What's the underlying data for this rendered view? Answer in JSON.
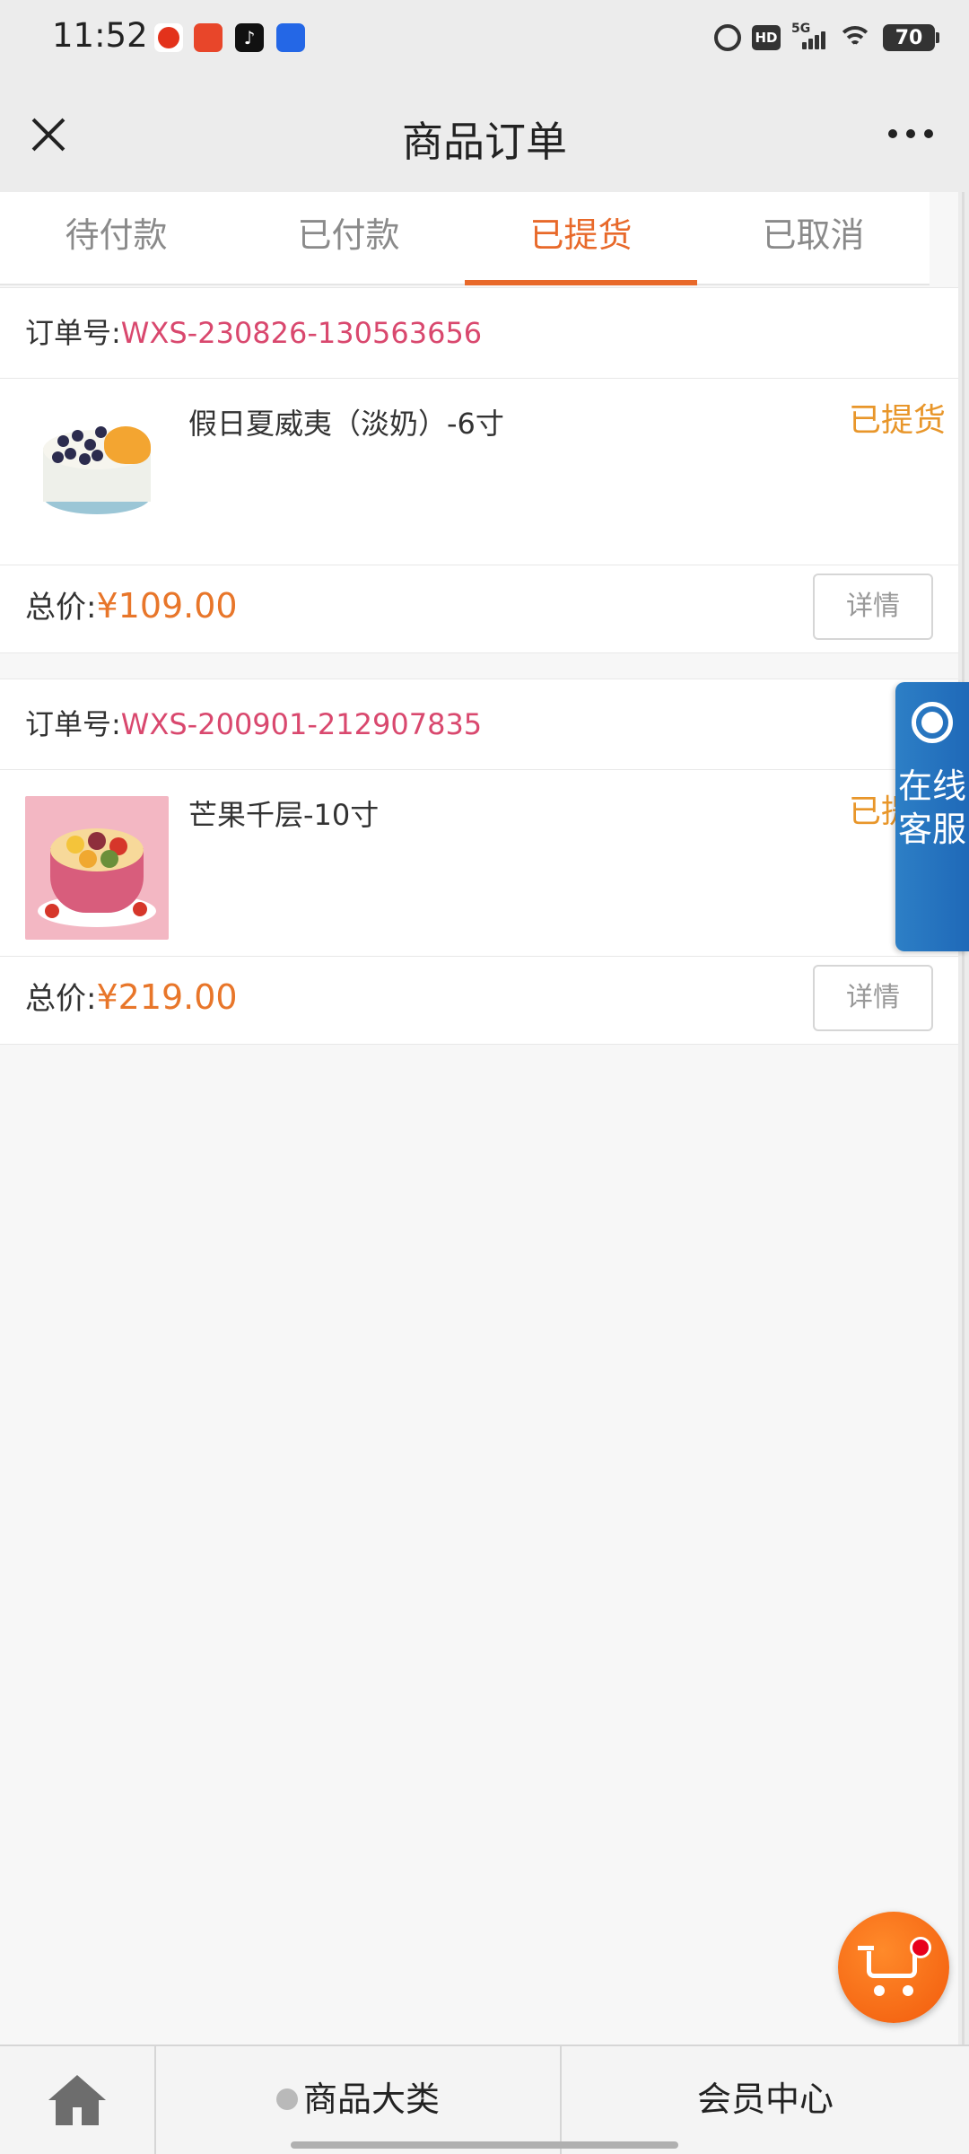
{
  "status_bar": {
    "time": "11:52",
    "network": "5G",
    "hd": "HD",
    "battery": "70"
  },
  "header": {
    "title": "商品订单"
  },
  "tabs": [
    {
      "label": "待付款",
      "active": false
    },
    {
      "label": "已付款",
      "active": false
    },
    {
      "label": "已提货",
      "active": true
    },
    {
      "label": "已取消",
      "active": false
    }
  ],
  "orders": [
    {
      "order_no_label": "订单号:",
      "order_no": "WXS-230826-130563656",
      "product_name": "假日夏威夷（淡奶）-6寸",
      "status": "已提货",
      "total_label": "总价:",
      "total_price": "¥109.00",
      "detail_label": "详情"
    },
    {
      "order_no_label": "订单号:",
      "order_no": "WXS-200901-212907835",
      "product_name": "芒果千层-10寸",
      "status": "已提货",
      "total_label": "总价:",
      "total_price": "¥219.00",
      "detail_label": "详情"
    }
  ],
  "floating_service": {
    "label": "在线客服"
  },
  "bottom_nav": {
    "category_label": "商品大类",
    "member_label": "会员中心"
  },
  "colors": {
    "accent": "#e8692a",
    "order_no": "#d9486e",
    "price": "#e8762a",
    "status": "#e8962a",
    "service": "#2d7fc6"
  }
}
